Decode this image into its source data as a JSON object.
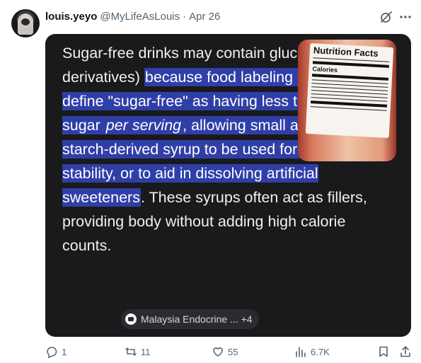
{
  "post": {
    "author_name": "louis.yeyo",
    "author_handle": "@MyLifeAsLouis",
    "separator": "·",
    "date": "Apr 26"
  },
  "card": {
    "seg1": "Sugar-free drinks may contain glucose syrup (or derivatives) ",
    "seg2": "because food labeling laws often define \"sugar-free\" as having less than 0.5g of sugar ",
    "seg3": "per serving",
    "seg4": ", allowing small amounts of starch-derived syrup to be used for texture, stability, or to aid in dissolving artificial sweeteners",
    "seg5": ". These syrups often act as fillers, providing body without adding high calorie counts. ",
    "source_chip": "Malaysia Endocrine ... +4",
    "thumbnail_label_title": "Nutrition Facts",
    "thumbnail_label_calories": "Calories",
    "highlight_color": "#2f3fa8"
  },
  "actions": {
    "replies": "1",
    "reposts": "11",
    "likes": "55",
    "views": "6.7K"
  },
  "icons": [
    "grok-icon",
    "more-icon",
    "reply-icon",
    "repost-icon",
    "like-icon",
    "views-icon",
    "bookmark-icon",
    "share-icon"
  ]
}
